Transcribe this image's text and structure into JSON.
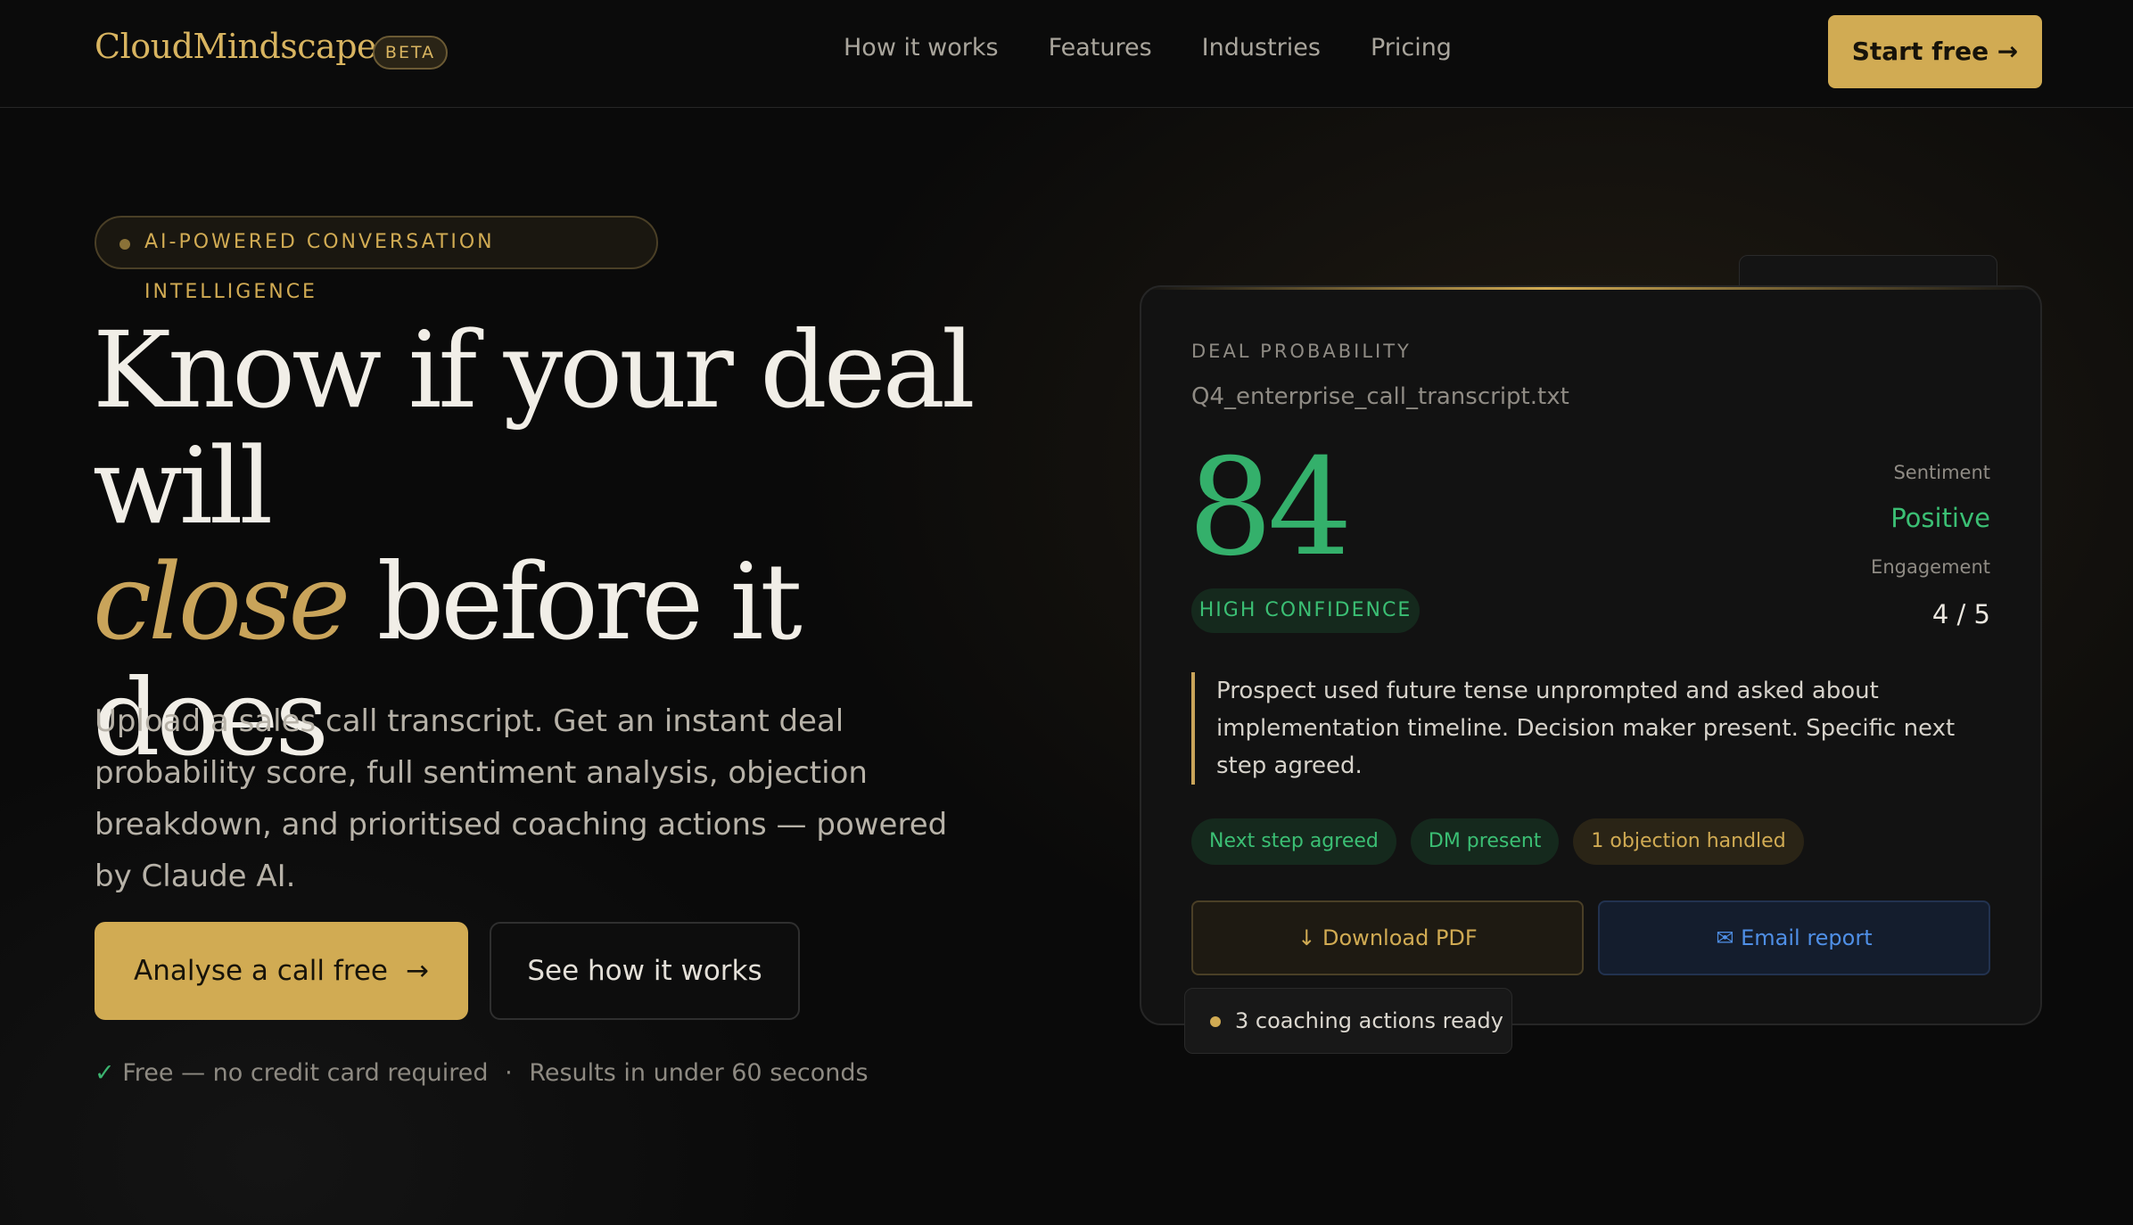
{
  "nav": {
    "logo": "CloudMindscape",
    "badge": "BETA",
    "links": [
      "How it works",
      "Features",
      "Industries",
      "Pricing"
    ],
    "cta": "Start free →"
  },
  "hero": {
    "eyebrow": "AI-POWERED CONVERSATION INTELLIGENCE",
    "headline_line1": "Know if your deal will",
    "headline_accent": "close",
    "headline_line2": " before it does",
    "subcopy": "Upload a sales call transcript. Get an instant deal probability score, full sentiment analysis, objection breakdown, and prioritised coaching actions — powered by Claude AI.",
    "cta_primary": "Analyse a call free",
    "cta_primary_arrow": "→",
    "cta_secondary": "See how it works",
    "fine_check": "✓",
    "fine_free": "Free — no credit card required",
    "fine_sep": "·",
    "fine_results": "Results in under 60 seconds"
  },
  "card": {
    "label": "DEAL PROBABILITY",
    "file": "Q4_enterprise_call_transcript.txt",
    "score": "84",
    "confidence": "HIGH CONFIDENCE",
    "sentiment_label": "Sentiment",
    "sentiment_value": "Positive",
    "engagement_label": "Engagement",
    "engagement_value": "4 / 5",
    "quote": "Prospect used future tense unprompted and asked about implementation timeline. Decision maker present. Specific next step agreed.",
    "tags": [
      "Next step agreed",
      "DM present",
      "1 objection handled"
    ],
    "download_label": "↓ Download PDF",
    "email_label": "✉ Email report"
  },
  "toast": {
    "text": "3 coaching actions ready"
  },
  "colors": {
    "accent": "#d1ab53",
    "success": "#34b06b",
    "link": "#4f8fe6",
    "background": "#0a0a0a"
  }
}
